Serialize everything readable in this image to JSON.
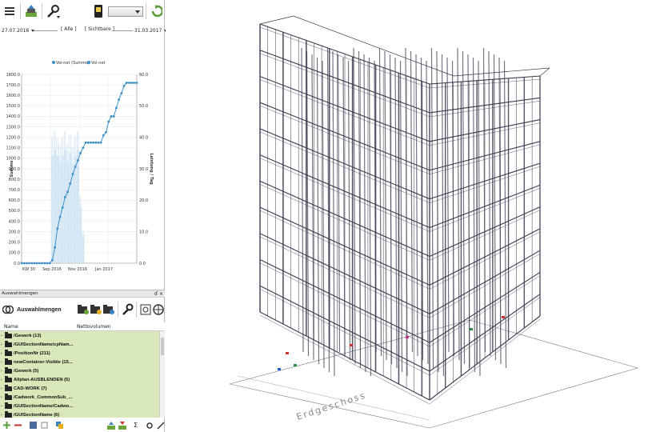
{
  "toolbar": {
    "menu_icon": "hamburger-menu-icon",
    "export_icon": "export-icon",
    "tools_icon": "wrench-icon",
    "phone_icon": "device-icon",
    "refresh_icon": "refresh-icon",
    "view_select_value": ""
  },
  "filters": {
    "start_date": "27.07.2016",
    "end_date": "31.03.2017",
    "all_label": "[ Alle ]",
    "visible_label": "[ Sichtbare ]"
  },
  "chart_data": {
    "type": "bar+line",
    "legend": [
      "Vol-net (Summe)",
      "Vol-net"
    ],
    "ylabel_left": "Summe",
    "ylabel_right": "Leistung / Tag",
    "ylim_left": [
      0,
      1800
    ],
    "ylim_right": [
      0,
      60
    ],
    "yticks_left": [
      "0.0",
      "100.0",
      "200.0",
      "300.0",
      "400.0",
      "500.0",
      "600.0",
      "700.0",
      "800.0",
      "900.0",
      "1000.0",
      "1100.0",
      "1200.0",
      "1300.0",
      "1400.0",
      "1500.0",
      "1600.0",
      "1700.0",
      "1800.0"
    ],
    "yticks_right": [
      "0.0",
      "10.0",
      "20.0",
      "30.0",
      "40.0",
      "50.0",
      "60.0"
    ],
    "xticks": [
      "KW 30",
      "Sep 2016",
      "Nov 2016",
      "Jan 2017"
    ],
    "line_series": {
      "name": "Vol-net (Summe)",
      "color": "#3b8fc6",
      "values": [
        0,
        0,
        0,
        0,
        0,
        0,
        0,
        0,
        0,
        0,
        0,
        0,
        30,
        150,
        330,
        440,
        530,
        630,
        680,
        760,
        850,
        920,
        980,
        1050,
        1100,
        1150,
        1150,
        1150,
        1150,
        1150,
        1150,
        1150,
        1220,
        1250,
        1350,
        1400,
        1400,
        1480,
        1560,
        1620,
        1690,
        1720,
        1720,
        1720,
        1720,
        1720
      ]
    },
    "bar_series": {
      "name": "Vol-net",
      "color": "#c8dff0",
      "note_values_per_day": [
        0,
        0,
        0,
        0,
        0,
        0,
        0,
        0,
        0,
        0,
        0,
        0,
        38,
        40,
        38,
        36,
        38,
        40,
        36,
        39,
        35,
        38,
        40,
        20,
        10,
        0,
        0,
        0,
        0,
        0,
        0,
        0,
        0,
        0,
        0,
        0,
        0,
        0,
        0,
        0,
        0,
        0,
        0,
        0,
        0,
        0
      ]
    }
  },
  "selection_panel": {
    "header_title": "Auswahlmengen",
    "header_controls": "ɗ ×",
    "title": "Auswahlmengen",
    "col_name": "Name",
    "col_volume": "Nettovolumen",
    "rows": [
      "/Gewerk (13)",
      "/GUISectionName/cpNam...",
      "/PositionNr (211)",
      "newContainer-Visible (15...",
      "/Gewerk (5)",
      "Allplan-AUSBLENDEN (5)",
      "CAD-WORK (7)",
      "/Cadwork_CommonSub_...",
      "/GUISectionName/Cadwo...",
      "/GUISectionName (6)"
    ]
  },
  "bottom_bar": {
    "sum_icon": "Σ"
  },
  "viewport": {
    "floor_label": "Erdgeschoss",
    "line_color": "#3a3a4e"
  }
}
